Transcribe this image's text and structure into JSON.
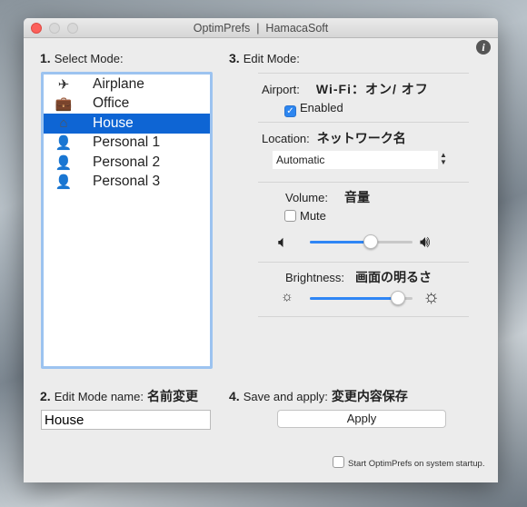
{
  "window": {
    "title": "OptimPrefs  |  HamacaSoft"
  },
  "step1": {
    "num": "1.",
    "label": "Select Mode:"
  },
  "modes": [
    {
      "label": "Airplane",
      "icon": "airplane-icon",
      "glyph": "✈"
    },
    {
      "label": "Office",
      "icon": "briefcase-icon",
      "glyph": "💼"
    },
    {
      "label": "House",
      "icon": "house-icon",
      "glyph": "⌂",
      "selected": true
    },
    {
      "label": "Personal 1",
      "icon": "person-icon",
      "glyph": "👤"
    },
    {
      "label": "Personal 2",
      "icon": "person-icon",
      "glyph": "👤"
    },
    {
      "label": "Personal 3",
      "icon": "person-icon",
      "glyph": "👤"
    }
  ],
  "step2": {
    "num": "2.",
    "label": "Edit Mode name:",
    "jp": "名前変更",
    "value": "House"
  },
  "step3": {
    "num": "3.",
    "label": "Edit Mode:"
  },
  "airport": {
    "label": "Airport:",
    "jp": "Wi-Fi：オン/ オフ",
    "enabled_label": "Enabled",
    "enabled": true
  },
  "location": {
    "label": "Location:",
    "jp": "ネットワーク名",
    "value": "Automatic"
  },
  "volume": {
    "label": "Volume:",
    "jp": "音量",
    "mute_label": "Mute",
    "muted": false,
    "level_percent": 59
  },
  "brightness": {
    "label": "Brightness:",
    "jp": "画面の明るさ",
    "level_percent": 86
  },
  "step4": {
    "num": "4.",
    "label": "Save and apply:",
    "jp": "変更内容保存",
    "apply": "Apply"
  },
  "startup": {
    "label": "Start OptimPrefs on system startup.",
    "checked": false
  },
  "colors": {
    "accent": "#0e65d4",
    "slider": "#2f86f5"
  }
}
